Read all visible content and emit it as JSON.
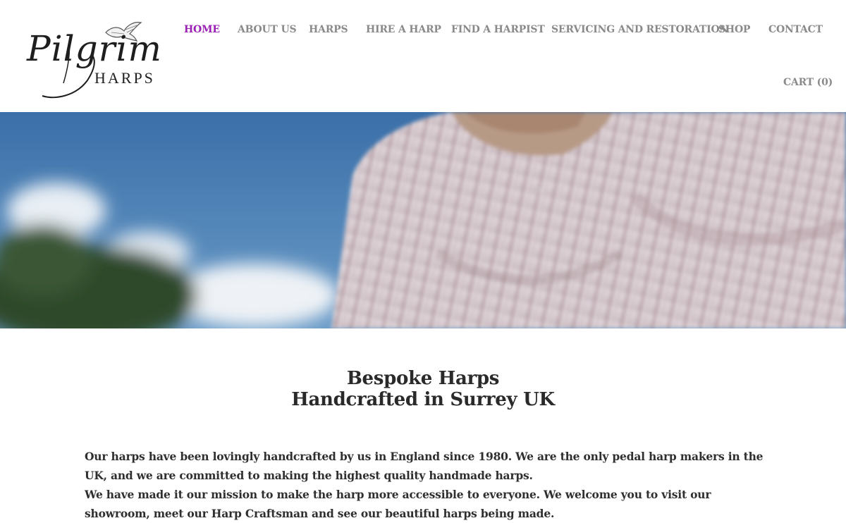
{
  "brand": {
    "logo_script": "Pilgrim",
    "logo_sub": "HARPS"
  },
  "nav": {
    "items": [
      {
        "label": "HOME",
        "active": true
      },
      {
        "label": "ABOUT US",
        "active": false
      },
      {
        "label": "HARPS",
        "active": false
      },
      {
        "label": "HIRE A HARP",
        "active": false
      },
      {
        "label": "FIND A HARPIST",
        "active": false
      },
      {
        "label": "SERVICING AND RESTORATION",
        "active": false
      },
      {
        "label": "SHOP",
        "active": false
      },
      {
        "label": "CONTACT",
        "active": false
      }
    ],
    "cart_label": "CART (0)",
    "active_color": "#9a1fb4",
    "text_color": "#8a8a8a"
  },
  "hero": {
    "icon": "hero-photo-man-striped-shirt"
  },
  "main": {
    "headline_line1": "Bespoke Harps",
    "headline_line2": "Handcrafted in Surrey UK",
    "paragraph_1": "Our harps have been lovingly handcrafted by us in England since 1980. We are the only pedal harp makers in the UK, and we are committed to making the highest quality handmade harps.",
    "paragraph_2": "We have made it our mission to make the harp more accessible to everyone.  We welcome you to visit our showroom, meet our Harp Craftsman and see our beautiful harps being made."
  }
}
